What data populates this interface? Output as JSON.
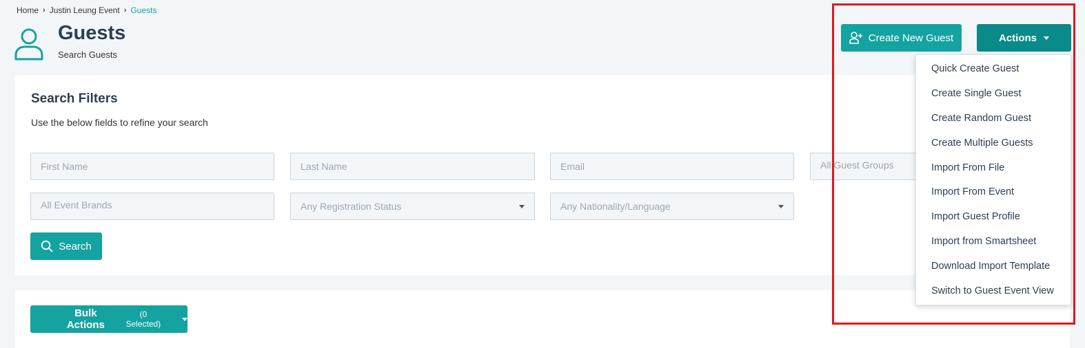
{
  "breadcrumb": {
    "home": "Home",
    "event": "Justin Leung Event",
    "current": "Guests"
  },
  "header": {
    "title": "Guests",
    "subtitle": "Search Guests"
  },
  "toolbar": {
    "create_label": "Create New Guest",
    "actions_label": "Actions"
  },
  "filters": {
    "title": "Search Filters",
    "description": "Use the below fields to refine your search",
    "first_name_placeholder": "First Name",
    "last_name_placeholder": "Last Name",
    "email_placeholder": "Email",
    "guest_groups_placeholder": "All Guest Groups",
    "event_brands_placeholder": "All Event Brands",
    "registration_status": "Any Registration Status",
    "nationality_language": "Any Nationality/Language",
    "search_label": "Search"
  },
  "bulk": {
    "label": "Bulk Actions",
    "count": "(0 Selected)"
  },
  "actions_menu": {
    "items": [
      "Quick Create Guest",
      "Create Single Guest",
      "Create Random Guest",
      "Create Multiple Guests",
      "Import From File",
      "Import From Event",
      "Import Guest Profile",
      "Import from Smartsheet",
      "Download Import Template",
      "Switch to Guest Event View"
    ]
  },
  "colors": {
    "accent": "#14a3a0",
    "accent_dark": "#0a8a88",
    "highlight": "#e0161b"
  },
  "icons": {
    "header": "user-icon",
    "create": "user-plus-icon",
    "search": "search-icon"
  }
}
